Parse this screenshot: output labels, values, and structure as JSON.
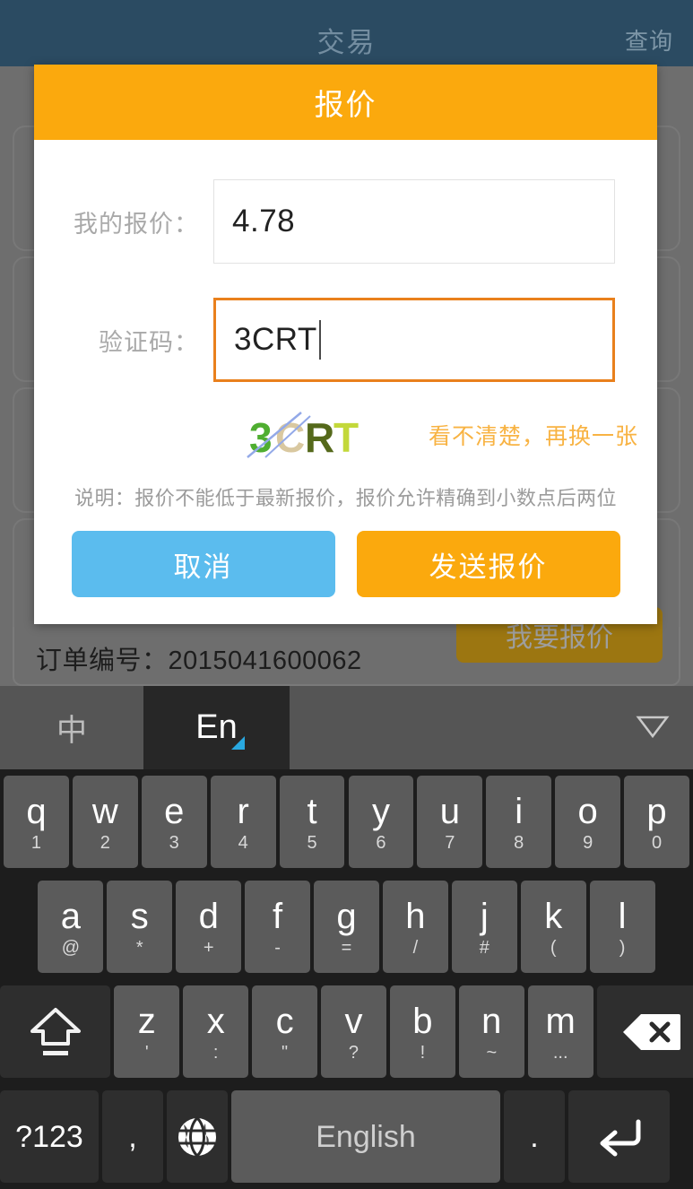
{
  "app": {
    "topbar": {
      "title": "交易",
      "right_action": "查询"
    },
    "order": {
      "order_label": "订单编号：2015041600062",
      "quote_button": "我要报价"
    }
  },
  "modal": {
    "title": "报价",
    "fields": [
      {
        "label": "我的报价：",
        "value": "4.78",
        "placeholder": "",
        "focused": false
      },
      {
        "label": "验证码：",
        "value": "3CRT",
        "placeholder": "",
        "focused": true
      }
    ],
    "captcha": {
      "text": "3CRT",
      "chars": [
        {
          "ch": "3",
          "color": "#4FAE30"
        },
        {
          "ch": "C",
          "color": "#D9C8A0"
        },
        {
          "ch": "R",
          "color": "#55691B"
        },
        {
          "ch": "T",
          "color": "#C3D83A"
        }
      ],
      "line_color": "#93A9E8",
      "refresh_label": "看不清楚，再换一张"
    },
    "note": "说明：报价不能低于最新报价，报价允许精确到小数点后两位",
    "buttons": {
      "cancel": "取消",
      "submit": "发送报价"
    },
    "colors": {
      "header": "#FBA90D",
      "submit": "#FBA90D",
      "cancel": "#5BBCEE",
      "focus_border": "#E9801C",
      "link": "#F8B343"
    }
  },
  "keyboard": {
    "toolbar": {
      "lang_cn": "中",
      "lang_en": "En",
      "hide_icon": "chevron-down-icon",
      "active": "En"
    },
    "rows": [
      [
        {
          "main": "q",
          "sub": "1"
        },
        {
          "main": "w",
          "sub": "2"
        },
        {
          "main": "e",
          "sub": "3"
        },
        {
          "main": "r",
          "sub": "4"
        },
        {
          "main": "t",
          "sub": "5"
        },
        {
          "main": "y",
          "sub": "6"
        },
        {
          "main": "u",
          "sub": "7"
        },
        {
          "main": "i",
          "sub": "8"
        },
        {
          "main": "o",
          "sub": "9"
        },
        {
          "main": "p",
          "sub": "0"
        }
      ],
      [
        {
          "main": "a",
          "sub": "@"
        },
        {
          "main": "s",
          "sub": "*"
        },
        {
          "main": "d",
          "sub": "+"
        },
        {
          "main": "f",
          "sub": "-"
        },
        {
          "main": "g",
          "sub": "="
        },
        {
          "main": "h",
          "sub": "/"
        },
        {
          "main": "j",
          "sub": "#"
        },
        {
          "main": "k",
          "sub": "("
        },
        {
          "main": "l",
          "sub": ")"
        }
      ],
      [
        {
          "main": "",
          "sub": "",
          "icon": "shift-icon"
        },
        {
          "main": "z",
          "sub": "'"
        },
        {
          "main": "x",
          "sub": ":"
        },
        {
          "main": "c",
          "sub": "\""
        },
        {
          "main": "v",
          "sub": "?"
        },
        {
          "main": "b",
          "sub": "!"
        },
        {
          "main": "n",
          "sub": "~"
        },
        {
          "main": "m",
          "sub": "..."
        },
        {
          "main": "",
          "sub": "",
          "icon": "backspace-icon"
        }
      ],
      [
        {
          "main": "?123",
          "sub": ""
        },
        {
          "main": ",",
          "sub": ""
        },
        {
          "main": "",
          "sub": "",
          "icon": "globe-icon"
        },
        {
          "main": "English",
          "sub": ""
        },
        {
          "main": ".",
          "sub": ""
        },
        {
          "main": "",
          "sub": "",
          "icon": "enter-icon"
        }
      ]
    ],
    "space_label": "English",
    "symbols_label": "?123"
  }
}
